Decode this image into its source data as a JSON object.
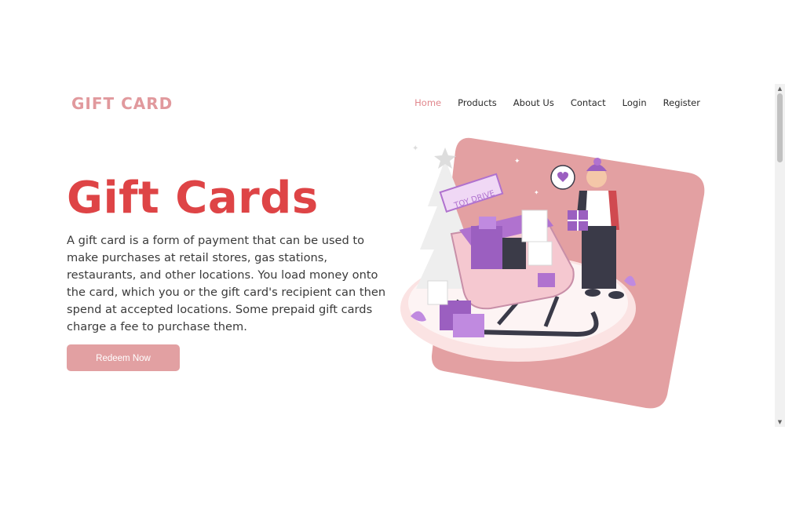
{
  "brand": {
    "name": "GIFT CARD"
  },
  "nav": {
    "items": [
      "Home",
      "Products",
      "About Us",
      "Contact",
      "Login",
      "Register"
    ],
    "active": "Home"
  },
  "hero": {
    "title": "Gift Cards",
    "description": "A gift card is a form of payment that can be used to make purchases at retail stores, gas stations, restaurants, and other locations. You load money onto the card, which you or the gift card's recipient can then spend at accepted locations. Some prepaid gift cards charge a fee to purchase them.",
    "cta_label": "Redeem Now"
  },
  "illustration": {
    "sign_text": "TOY DRIVE",
    "icon": "sleigh-gifts-illustration"
  },
  "colors": {
    "brand": "#e1999d",
    "title": "#de4446",
    "accent_bg": "#e2a0a2",
    "nav_active": "#e1878d"
  }
}
